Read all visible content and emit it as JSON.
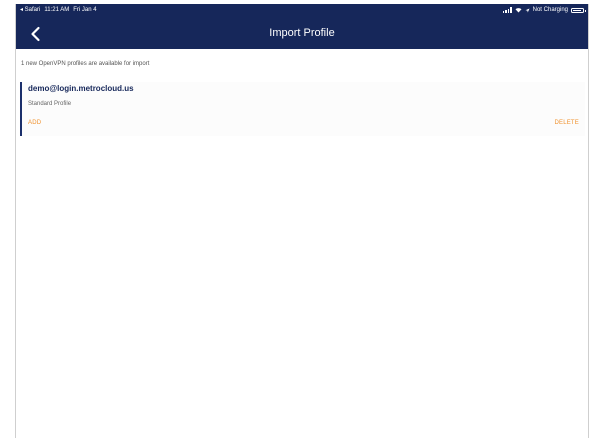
{
  "status_bar": {
    "back_app": "◂ Safari",
    "time": "11:21 AM",
    "date": "Fri Jan 4",
    "charging": "Not Charging"
  },
  "nav": {
    "title": "Import Profile",
    "back_icon": "chevron-left-icon"
  },
  "main": {
    "info": "1 new OpenVPN profiles are available for import",
    "profiles": [
      {
        "host": "demo@login.metrocloud.us",
        "type": "Standard Profile",
        "add_label": "ADD",
        "delete_label": "DELETE"
      }
    ]
  },
  "colors": {
    "navbar": "#16275a",
    "accent": "#f0922e",
    "host_text": "#16275a"
  }
}
